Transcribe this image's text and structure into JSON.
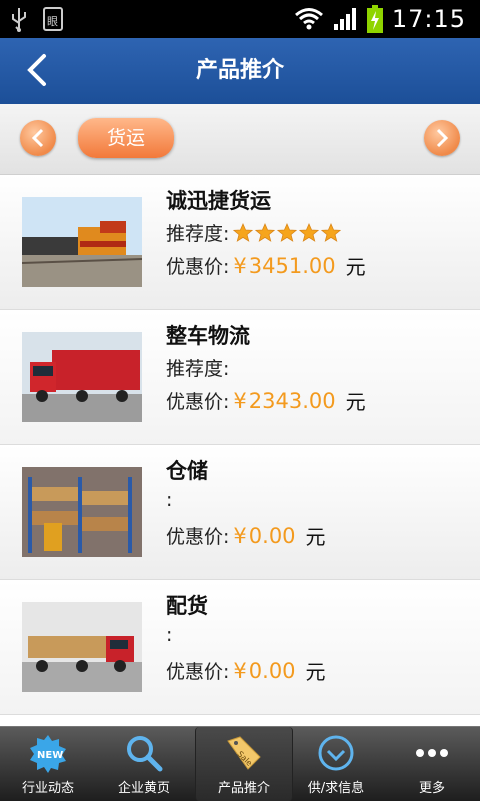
{
  "status_bar": {
    "time": "17:15"
  },
  "header": {
    "title": "产品推介"
  },
  "category_bar": {
    "selected": "货运"
  },
  "products": [
    {
      "name": "诚迅捷货运",
      "rec_label": "推荐度:",
      "rating": 5,
      "price_label": "优惠价:",
      "currency": "¥",
      "price": "3451.00",
      "unit": "元"
    },
    {
      "name": "整车物流",
      "rec_label": "推荐度:",
      "rating": 0,
      "price_label": "优惠价:",
      "currency": "¥",
      "price": "2343.00",
      "unit": "元"
    },
    {
      "name": "仓储",
      "rec_label": ":",
      "rating": 0,
      "price_label": "优惠价:",
      "currency": "¥",
      "price": "0.00",
      "unit": "元"
    },
    {
      "name": "配货",
      "rec_label": ":",
      "rating": 0,
      "price_label": "优惠价:",
      "currency": "¥",
      "price": "0.00",
      "unit": "元"
    }
  ],
  "tabbar": {
    "tabs": [
      {
        "label": "行业动态",
        "icon": "new-badge-icon"
      },
      {
        "label": "企业黄页",
        "icon": "search-icon"
      },
      {
        "label": "产品推介",
        "icon": "sale-tag-icon",
        "active": true
      },
      {
        "label": "供/求信息",
        "icon": "clock-icon"
      },
      {
        "label": "更多",
        "icon": "more-dots-icon"
      }
    ]
  },
  "colors": {
    "header": "#1c4f98",
    "accent": "#f2793a",
    "price": "#f39a1e"
  }
}
